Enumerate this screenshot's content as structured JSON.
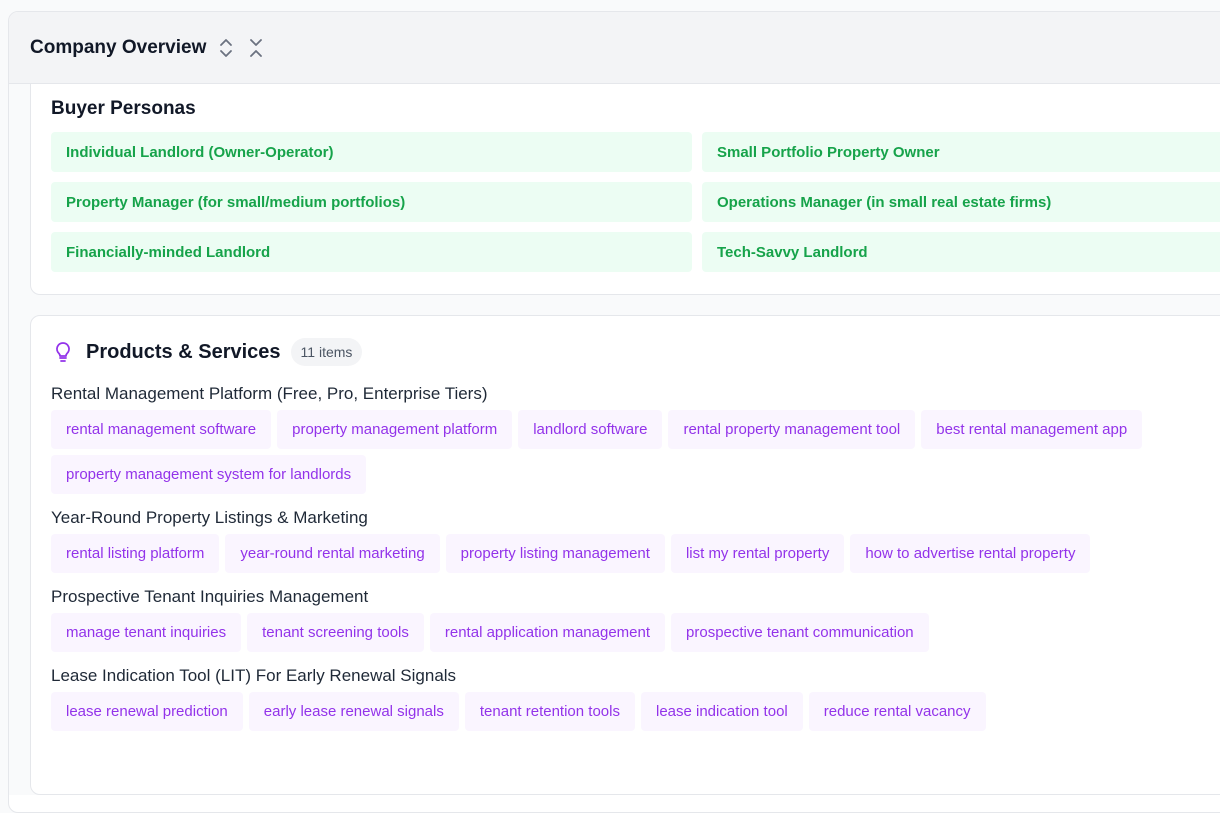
{
  "header": {
    "title": "Company Overview"
  },
  "personas": {
    "title": "Buyer Personas",
    "items": [
      "Individual Landlord (Owner-Operator)",
      "Small Portfolio Property Owner",
      "Property Manager (for small/medium portfolios)",
      "Operations Manager (in small real estate firms)",
      "Financially-minded Landlord",
      "Tech-Savvy Landlord"
    ]
  },
  "products": {
    "title": "Products & Services",
    "count_label": "11 items",
    "groups": [
      {
        "title": "Rental Management Platform (Free, Pro, Enterprise Tiers)",
        "tags": [
          "rental management software",
          "property management platform",
          "landlord software",
          "rental property management tool",
          "best rental management app",
          "property management system for landlords"
        ]
      },
      {
        "title": "Year-Round Property Listings & Marketing",
        "tags": [
          "rental listing platform",
          "year-round rental marketing",
          "property listing management",
          "list my rental property",
          "how to advertise rental property"
        ]
      },
      {
        "title": "Prospective Tenant Inquiries Management",
        "tags": [
          "manage tenant inquiries",
          "tenant screening tools",
          "rental application management",
          "prospective tenant communication"
        ]
      },
      {
        "title": "Lease Indication Tool (LIT) For Early Renewal Signals",
        "tags": [
          "lease renewal prediction",
          "early lease renewal signals",
          "tenant retention tools",
          "lease indication tool",
          "reduce rental vacancy"
        ]
      }
    ]
  },
  "colors": {
    "persona_bg": "#ecfdf3",
    "persona_text": "#16a34a",
    "tag_bg": "#faf5ff",
    "tag_text": "#9333ea",
    "icon": "#9333ea"
  },
  "icons": {
    "header": [
      "chevron-up-down-icon",
      "collapse-icon"
    ],
    "products": "lightbulb-icon"
  }
}
